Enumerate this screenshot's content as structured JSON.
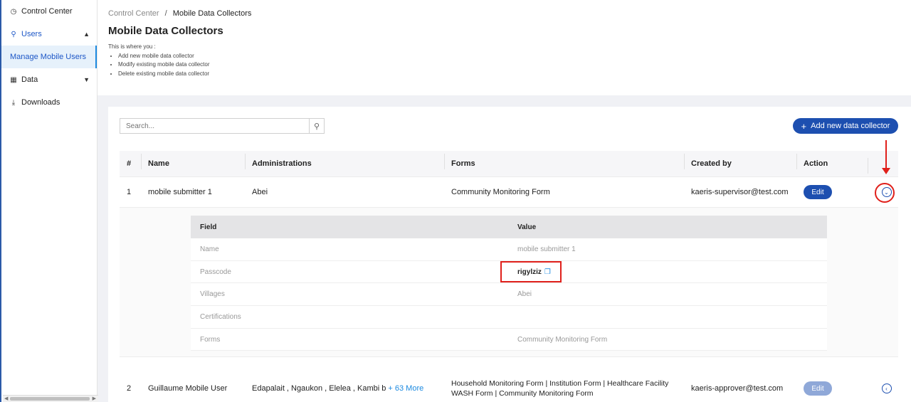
{
  "sidebar": {
    "items": [
      {
        "label": "Control Center",
        "icon": "dashboard-icon",
        "glyph": "◷"
      },
      {
        "label": "Users",
        "icon": "user-icon",
        "glyph": "⚲",
        "chevron": "▲"
      },
      {
        "label": "Manage Mobile Users"
      },
      {
        "label": "Data",
        "icon": "table-icon",
        "glyph": "▦",
        "chevron": "▼"
      },
      {
        "label": "Downloads",
        "icon": "download-icon",
        "glyph": "⤓"
      }
    ]
  },
  "breadcrumb": {
    "parent": "Control Center",
    "separator": "/",
    "current": "Mobile Data Collectors"
  },
  "page_title": "Mobile Data Collectors",
  "description": {
    "intro": "This is where you :",
    "points": [
      "Add new mobile data collector",
      "Modify existing mobile data collector",
      "Delete existing mobile data collector"
    ]
  },
  "search": {
    "placeholder": "Search..."
  },
  "add_button": {
    "label": "Add new data collector"
  },
  "table": {
    "headers": [
      "#",
      "Name",
      "Administrations",
      "Forms",
      "Created by",
      "Action"
    ],
    "rows": [
      {
        "index": "1",
        "name": "mobile submitter 1",
        "administrations": "Abei",
        "forms": "Community Monitoring Form",
        "created_by": "kaeris-supervisor@test.com",
        "action": "Edit"
      },
      {
        "index": "2",
        "name": "Guillaume Mobile User",
        "administrations": "Edapalait , Ngaukon , Elelea , Kambi b",
        "more": "+ 63 More",
        "forms_line1": "Household Monitoring Form | Institution Form | Healthcare Facility",
        "forms_line2": "WASH Form | Community Monitoring Form",
        "created_by": "kaeris-approver@test.com",
        "action": "Edit"
      }
    ]
  },
  "details": {
    "headers": [
      "Field",
      "Value"
    ],
    "rows": [
      {
        "field": "Name",
        "value": "mobile submitter 1"
      },
      {
        "field": "Passcode",
        "value": "rigylziz"
      },
      {
        "field": "Villages",
        "value": "Abei"
      },
      {
        "field": "Certifications",
        "value": ""
      },
      {
        "field": "Forms",
        "value": "Community Monitoring Form"
      }
    ]
  },
  "colors": {
    "primary": "#1d4fb0",
    "highlight": "#e0201b",
    "link": "#1d8ae0"
  }
}
